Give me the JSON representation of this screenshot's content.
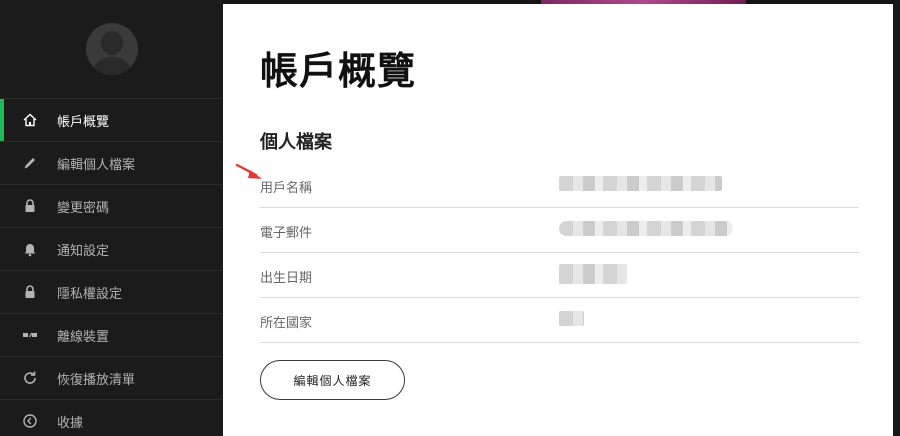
{
  "page": {
    "title": "帳戶概覽",
    "section_title": "個人檔案"
  },
  "sidebar": {
    "items": [
      {
        "label": "帳戶概覽",
        "icon": "home-icon",
        "active": true
      },
      {
        "label": "編輯個人檔案",
        "icon": "pencil-icon",
        "active": false
      },
      {
        "label": "變更密碼",
        "icon": "lock-icon",
        "active": false
      },
      {
        "label": "通知設定",
        "icon": "bell-icon",
        "active": false
      },
      {
        "label": "隱私權設定",
        "icon": "lock-icon",
        "active": false
      },
      {
        "label": "離線裝置",
        "icon": "offline-devices-icon",
        "active": false
      },
      {
        "label": "恢復播放清單",
        "icon": "refresh-icon",
        "active": false
      },
      {
        "label": "收據",
        "icon": "clock-icon",
        "active": false
      }
    ]
  },
  "profile": {
    "rows": [
      {
        "label": "用戶名稱",
        "value_state": "blurred"
      },
      {
        "label": "電子郵件",
        "value_state": "blurred"
      },
      {
        "label": "出生日期",
        "value_state": "blurred"
      },
      {
        "label": "所在國家",
        "value_state": "blurred"
      }
    ],
    "edit_button_label": "編輯個人檔案"
  },
  "colors": {
    "accent": "#1db954",
    "sidebar_bg": "#1b1b1b",
    "annotation_arrow": "#e53935"
  }
}
